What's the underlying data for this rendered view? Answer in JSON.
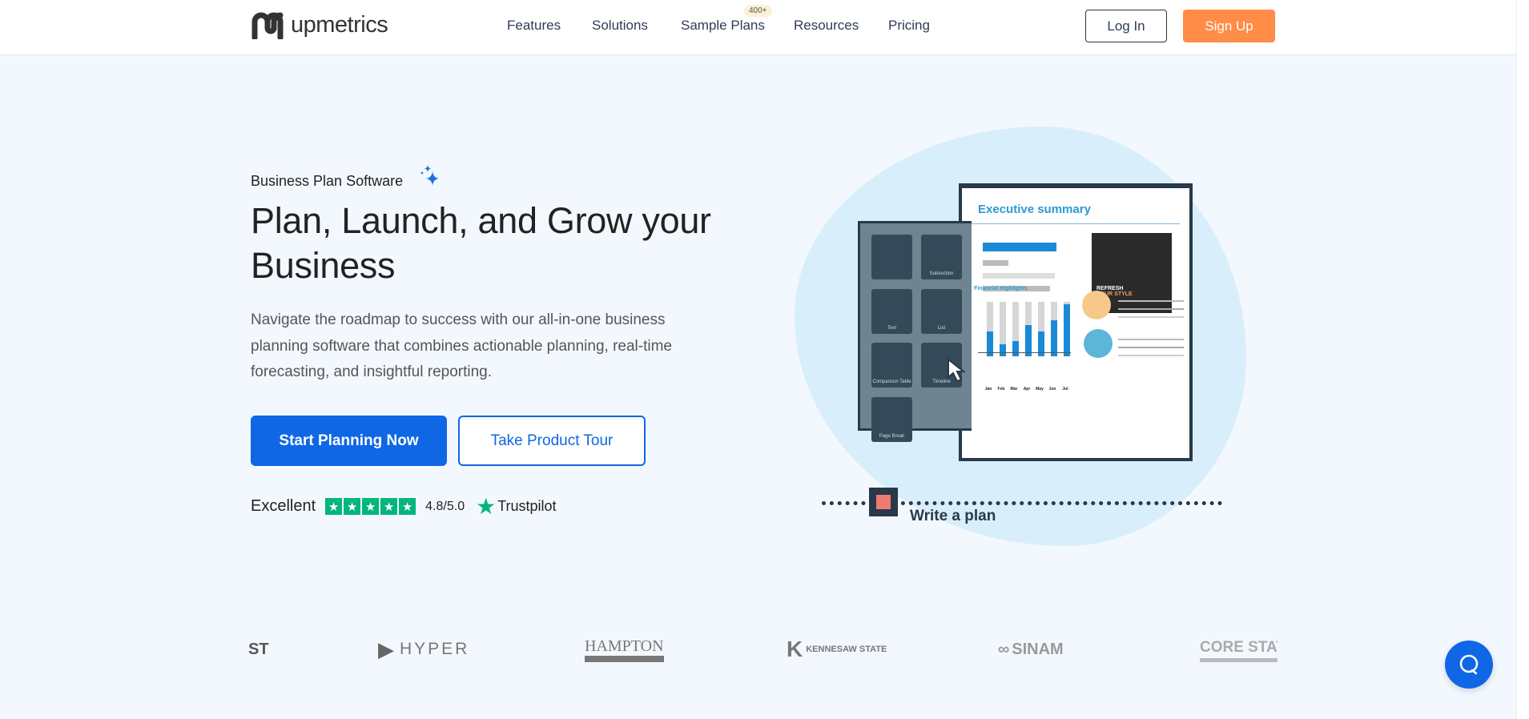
{
  "brand": {
    "name": "upmetrics"
  },
  "nav": {
    "items": [
      "Features",
      "Solutions",
      "Sample Plans",
      "Resources",
      "Pricing"
    ],
    "sample_badge": "400+",
    "login": "Log In",
    "signup": "Sign Up"
  },
  "hero": {
    "eyebrow": "Business Plan Software",
    "title": "Plan, Launch, and Grow your Business",
    "description": "Navigate the roadmap to success with our all-in-one business planning software that combines actionable planning, real-time forecasting, and insightful reporting.",
    "cta_primary": "Start Planning Now",
    "cta_secondary": "Take Product Tour"
  },
  "rating": {
    "label": "Excellent",
    "stars": 5,
    "score": "4.8/5.0",
    "provider": "Trustpilot"
  },
  "illustration": {
    "doc_title": "Executive summary",
    "section": "Financial Highlights",
    "image_text": [
      "REFRESH",
      "YOUR STYLE"
    ],
    "tiles": [
      "Subsection",
      "Text",
      "List",
      "Comparison Table",
      "Timeline",
      "Page Break"
    ],
    "months": [
      "Jan",
      "Feb",
      "Mar",
      "Apr",
      "May",
      "Jun",
      "Jul"
    ],
    "bar_fill_pct": [
      45,
      22,
      28,
      58,
      45,
      66,
      95
    ],
    "step_label": "Write a plan"
  },
  "logos": [
    "ST",
    "HYPER",
    "HAMPTON",
    "KENNESAW STATE",
    "SINAM",
    "CORE STATE"
  ],
  "colors": {
    "primary": "#0f67e6",
    "signup": "#ff8c47",
    "trustpilot": "#00b67a"
  }
}
